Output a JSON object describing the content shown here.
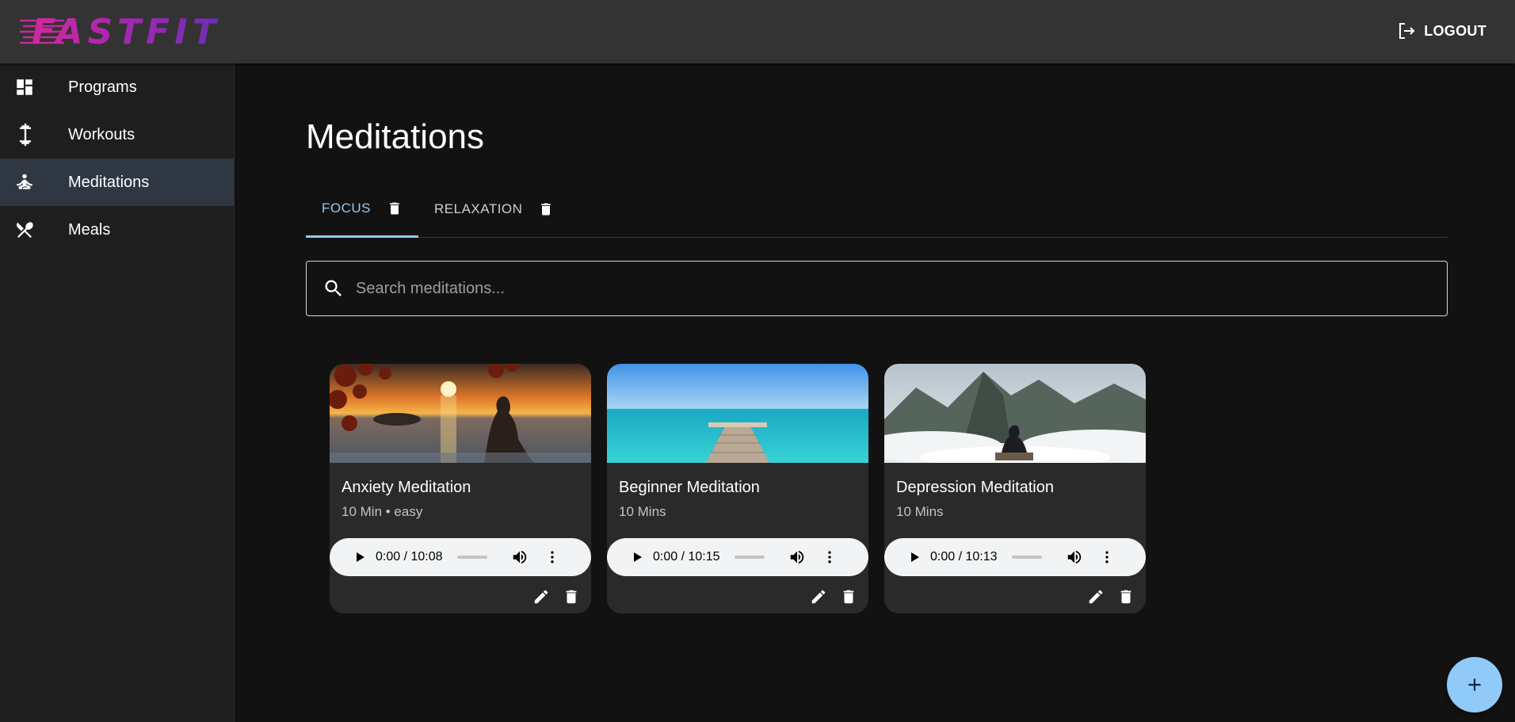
{
  "app": {
    "logo_text": "FASTFIT",
    "logout_label": "LOGOUT"
  },
  "sidebar": {
    "items": [
      {
        "label": "Programs",
        "icon": "dashboard-icon",
        "active": false
      },
      {
        "label": "Workouts",
        "icon": "dumbbell-icon",
        "active": false
      },
      {
        "label": "Meditations",
        "icon": "meditation-icon",
        "active": true
      },
      {
        "label": "Meals",
        "icon": "utensils-icon",
        "active": false
      }
    ]
  },
  "main": {
    "title": "Meditations",
    "tabs": [
      {
        "label": "FOCUS",
        "active": true
      },
      {
        "label": "RELAXATION",
        "active": false
      }
    ],
    "search": {
      "placeholder": "Search meditations...",
      "value": ""
    },
    "cards": [
      {
        "title": "Anxiety Meditation",
        "subtitle": "10 Min • easy",
        "time": "0:00 / 10:08",
        "image": "sunset-sea-meditation"
      },
      {
        "title": "Beginner Meditation",
        "subtitle": "10 Mins",
        "time": "0:00 / 10:15",
        "image": "tropical-pier"
      },
      {
        "title": "Depression Meditation",
        "subtitle": "10 Mins",
        "time": "0:00 / 10:13",
        "image": "mountain-meditation"
      }
    ]
  },
  "colors": {
    "accent": "#90caf9",
    "topbar": "#333333",
    "sidebar": "#1e1e1e",
    "background": "#121212",
    "card": "#2a2a2a"
  }
}
